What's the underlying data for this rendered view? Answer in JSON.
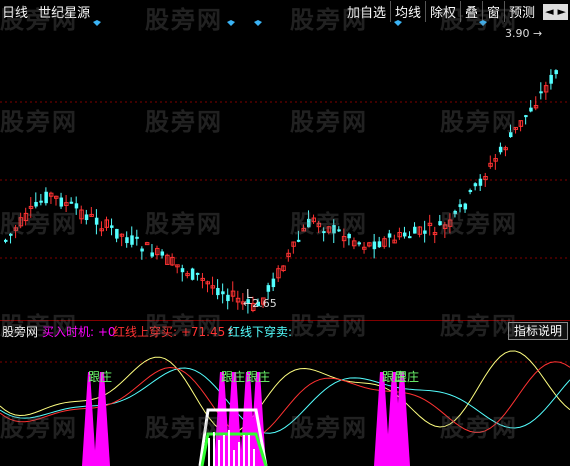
{
  "header": {
    "period": "日线",
    "stock_name": "世纪星源"
  },
  "toolbar": {
    "add_watch": "加自选",
    "ma": "均线",
    "exright": "除权",
    "overlay": "叠",
    "window": "窗",
    "forecast": "预测",
    "nav_prev": "◄",
    "nav_next": "►"
  },
  "chart": {
    "high_label": "3.90",
    "high_arrow": "→",
    "low_label": "2.65",
    "low_arrow": "←",
    "low_marker": "L",
    "colors": {
      "up": "#ff3232",
      "down": "#54ffff",
      "diamond": "#3ab3f5"
    }
  },
  "indicator": {
    "name": "股旁网",
    "buy_label": "买入时机: +0",
    "red_label": "红线上穿买: +71.45↑",
    "cyan_label": "红线下穿卖:",
    "help_button": "指标说明",
    "follow_tag": "跟庄",
    "colors": {
      "name": "#ffffff",
      "buy": "#ff00ff",
      "red": "#ff3232",
      "cyan": "#54ffff"
    }
  },
  "watermark": "股旁网"
}
